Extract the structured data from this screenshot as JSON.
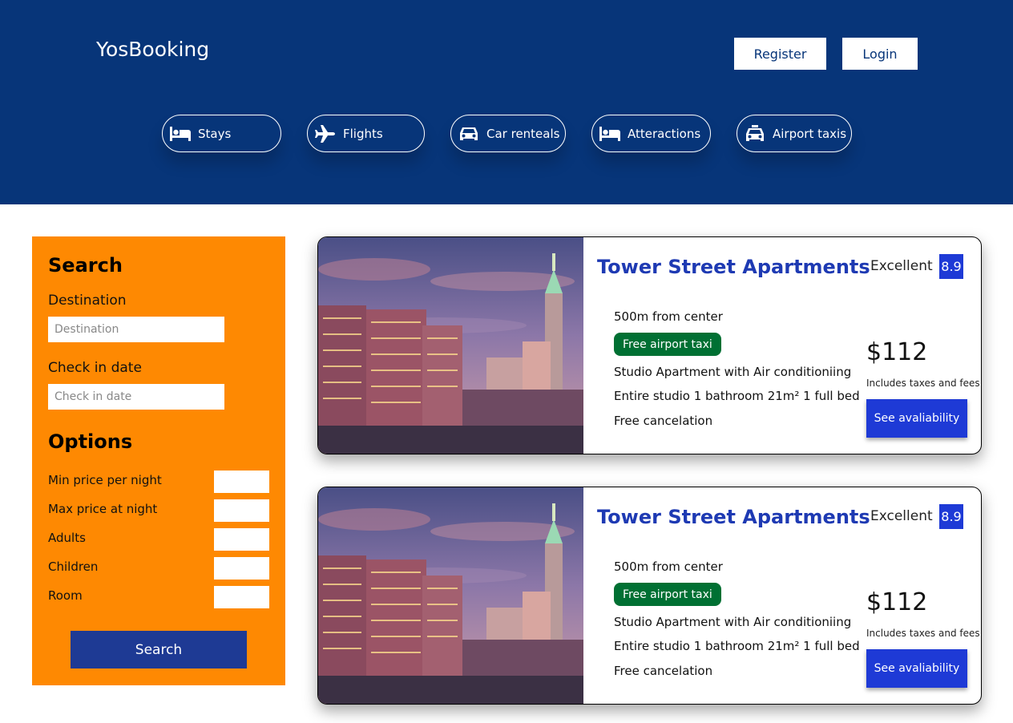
{
  "header": {
    "logo": "YosBooking",
    "register_label": "Register",
    "login_label": "Login",
    "nav": [
      {
        "label": "Stays",
        "icon": "bed-icon"
      },
      {
        "label": "Flights",
        "icon": "plane-icon"
      },
      {
        "label": "Car renteals",
        "icon": "car-icon"
      },
      {
        "label": "Atteractions",
        "icon": "bed-icon"
      },
      {
        "label": "Airport taxis",
        "icon": "taxi-icon"
      }
    ]
  },
  "sidebar": {
    "title": "Search",
    "destination_label": "Destination",
    "destination_placeholder": "Destination",
    "checkin_label": "Check in date",
    "checkin_placeholder": "Check in date",
    "options_title": "Options",
    "options": [
      {
        "label": "Min price per night"
      },
      {
        "label": "Max price at night"
      },
      {
        "label": "Adults"
      },
      {
        "label": "Children"
      },
      {
        "label": "Room"
      }
    ],
    "search_label": "Search"
  },
  "results": [
    {
      "title": "Tower Street Apartments",
      "rating_text": "Excellent",
      "rating": "8.9",
      "distance": "500m from center",
      "taxi": "Free airport taxi",
      "subtitle": "Studio Apartment with Air conditioniing",
      "features": "Entire studio 1 bathroom 21m² 1 full bed",
      "cancel": "Free cancelation",
      "price": "$112",
      "tax_note": "Includes taxes and fees",
      "button": "See avaliability"
    },
    {
      "title": "Tower Street Apartments",
      "rating_text": "Excellent",
      "rating": "8.9",
      "distance": "500m from center",
      "taxi": "Free airport taxi",
      "subtitle": "Studio Apartment with Air conditioniing",
      "features": "Entire studio 1 bathroom 21m² 1 full bed",
      "cancel": "Free cancelation",
      "price": "$112",
      "tax_note": "Includes taxes and fees",
      "button": "See avaliability"
    }
  ],
  "colors": {
    "header_bg": "#073579",
    "sidebar_bg": "#fe8902",
    "accent_blue": "#1e3ad6",
    "search_button": "#1e3a94",
    "taxi_green": "#007033"
  }
}
